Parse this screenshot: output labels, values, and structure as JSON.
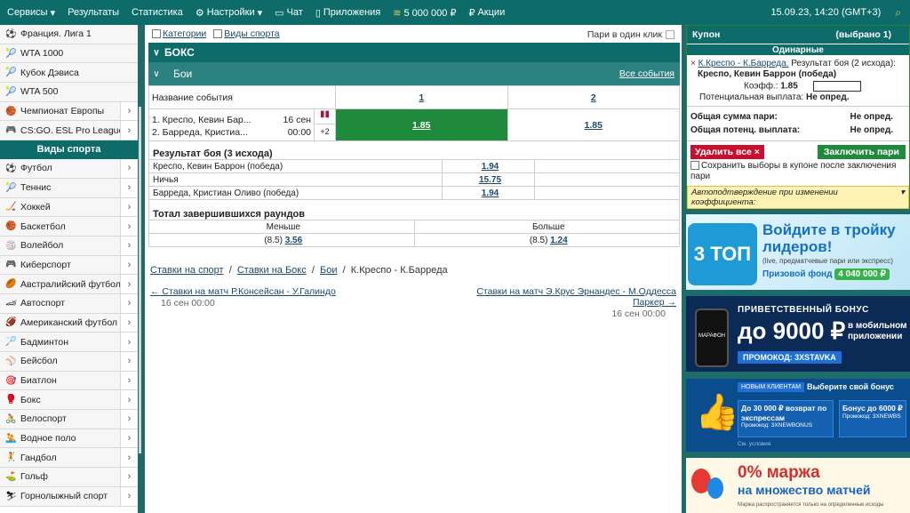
{
  "topbar": {
    "items": [
      "Сервисы",
      "Результаты",
      "Статистика",
      "Настройки",
      "Чат",
      "Приложения",
      "5 000 000 ₽",
      "Акции"
    ],
    "datetime": "15.09.23, 14:20 (GMT+3)"
  },
  "sidebar": {
    "top_items": [
      "Франция. Лига 1",
      "WTA 1000",
      "Кубок Дэвиса",
      "WTA 500",
      "Чемпионат Европы",
      "CS:GO. ESL Pro League"
    ],
    "section_title": "Виды спорта",
    "sports": [
      "Футбол",
      "Теннис",
      "Хоккей",
      "Баскетбол",
      "Волейбол",
      "Киберспорт",
      "Австралийский футбол",
      "Автоспорт",
      "Американский футбол",
      "Бадминтон",
      "Бейсбол",
      "Биатлон",
      "Бокс",
      "Велоспорт",
      "Водное поло",
      "Гандбол",
      "Гольф",
      "Горнолыжный спорт"
    ]
  },
  "filters": {
    "categories": "Категории",
    "sports": "Виды спорта",
    "one_click": "Пари в один клик"
  },
  "event": {
    "sport": "БОКС",
    "league": "Бои",
    "all_events": "Все события",
    "col_name": "Название события",
    "col_1": "1",
    "col_2": "2",
    "p1": "1. Креспо, Кевин Бар...",
    "p2": "2. Барреда, Кристиа...",
    "date": "16 сен",
    "time": "00:00",
    "more": "+2",
    "odd1": "1.85",
    "odd2": "1.85"
  },
  "market1": {
    "title": "Результат боя (3 исхода)",
    "rows": [
      {
        "name": "Креспо, Кевин Баррон (победа)",
        "odd": "1.94"
      },
      {
        "name": "Ничья",
        "odd": "15.75"
      },
      {
        "name": "Барреда, Кристиан Оливо (победа)",
        "odd": "1.94"
      }
    ]
  },
  "market2": {
    "title": "Тотал завершившихся раундов",
    "under": "Меньше",
    "over": "Больше",
    "under_line": "(8.5)",
    "under_odd": "3.56",
    "over_line": "(8.5)",
    "over_odd": "1.24"
  },
  "breadcrumbs": [
    "Ставки на спорт",
    "Ставки на Бокс",
    "Бои",
    "К.Креспо - К.Барреда"
  ],
  "nav": {
    "prev": "← Ставки на матч Р.Консейсан - У.Галиндо",
    "prev_date": "16 сен 00:00",
    "next": "Ставки на матч Э.Крус Эрнандес - М.Оддесса Паркер →",
    "next_date": "16 сен 00:00"
  },
  "coupon": {
    "title": "Купон",
    "count": "(выбрано 1)",
    "single": "Одинарные",
    "match": "К.Креспо - К.Барреда.",
    "market": "Результат боя (2 исхода):",
    "pick": "Креспо, Кевин Баррон (победа)",
    "coef_label": "Коэфф.:",
    "coef": "1.85",
    "payout_label": "Потенциальная выплата:",
    "payout": "Не опред.",
    "sum_label": "Общая сумма пари:",
    "sum": "Не опред.",
    "pot_label": "Общая потенц. выплата:",
    "pot": "Не опред.",
    "delete": "Удалить все ×",
    "place": "Заключить пари",
    "save": "Сохранить выборы в купоне после заключения пари",
    "auto": "Автоподтверждение при изменении коэффициента:"
  },
  "promos": {
    "p1": {
      "line1": "Войдите в тройку",
      "line2": "лидеров!",
      "note": "(live, предматчевые пари или экспресс)",
      "fund": "Призовой фонд",
      "amount": "4 040 000 ₽",
      "badge": "3 ТОП"
    },
    "p2": {
      "head": "ПРИВЕТСТВЕННЫЙ БОНУС",
      "amount": "до 9000 ₽",
      "line": "в мобильном приложении",
      "code": "ПРОМОКОД: 3XSTAVKA",
      "brand": "МАРАФОН"
    },
    "p3": {
      "tag": "НОВЫМ КЛИЕНТАМ",
      "choose": "Выберите свой бонус",
      "a": "До 30 000 ₽ возврат по экспрессам",
      "a_code": "3XNEWBONUS",
      "b": "Бонус до 6000 ₽",
      "b_code": "3XNEWBS",
      "terms": "См. условия",
      "promo_label": "Промокод:"
    },
    "p4": {
      "big": "0% маржа",
      "sub": "на множество матчей",
      "note": "Маржа распространяется только на определенные исходы"
    }
  }
}
